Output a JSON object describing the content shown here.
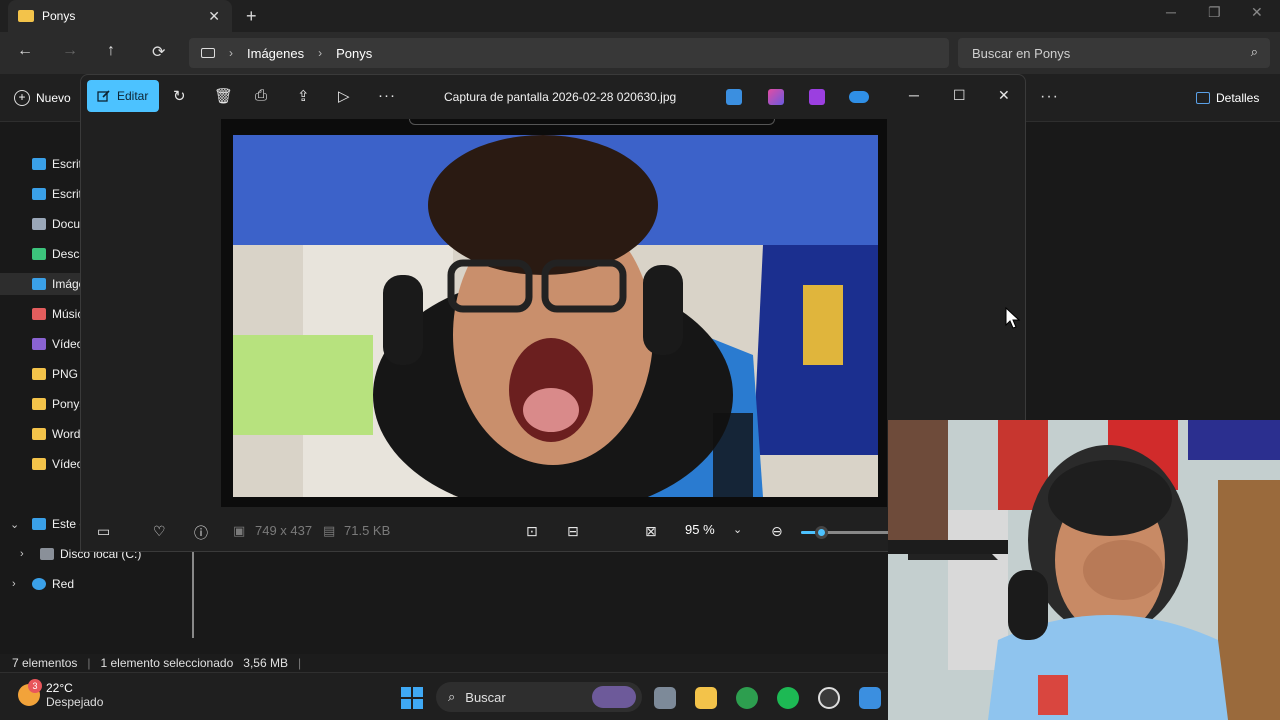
{
  "explorer": {
    "tab_title": "Ponys",
    "breadcrumb": [
      "Imágenes",
      "Ponys"
    ],
    "search_placeholder": "Buscar en Ponys",
    "new_label": "Nuevo",
    "details_label": "Detalles",
    "sidebar": [
      {
        "label": "Escrito",
        "icon": "desktop-icon",
        "color": "#3aa0e8"
      },
      {
        "label": "Escrito",
        "icon": "desktop-icon",
        "color": "#3aa0e8"
      },
      {
        "label": "Docum",
        "icon": "document-icon",
        "color": "#9aa7b8"
      },
      {
        "label": "Desca",
        "icon": "download-icon",
        "color": "#3cc47c"
      },
      {
        "label": "Imáge",
        "icon": "images-icon",
        "color": "#3aa0e8"
      },
      {
        "label": "Músic",
        "icon": "music-icon",
        "color": "#e35d5d"
      },
      {
        "label": "Vídeo",
        "icon": "video-icon",
        "color": "#8a63d2"
      },
      {
        "label": "PNG",
        "icon": "folder-icon",
        "color": "#f3c34a"
      },
      {
        "label": "Ponys",
        "icon": "folder-icon",
        "color": "#f3c34a"
      },
      {
        "label": "Word",
        "icon": "folder-icon",
        "color": "#f3c34a"
      },
      {
        "label": "Vídeo",
        "icon": "folder-icon",
        "color": "#f3c34a"
      }
    ],
    "tree": [
      {
        "label": "Este e",
        "icon": "pc-icon"
      },
      {
        "label": "Disco local (C:)",
        "icon": "drive-icon"
      },
      {
        "label": "Red",
        "icon": "network-icon"
      }
    ],
    "status": {
      "count": "7 elementos",
      "selection": "1 elemento seleccionado",
      "size": "3,56 MB"
    }
  },
  "photos": {
    "edit_label": "Editar",
    "file_title": "Captura de pantalla 2026-02-28 020630.jpg",
    "dimensions": "749 x 437",
    "file_size": "71.5 KB",
    "zoom": "95 %",
    "zoom_fraction": 0.2
  },
  "taskbar": {
    "temperature": "22°C",
    "weather": "Despejado",
    "weather_badge": "3",
    "search_label": "Buscar"
  },
  "colors": {
    "accent": "#4cc2ff",
    "folder": "#f3c34a"
  }
}
